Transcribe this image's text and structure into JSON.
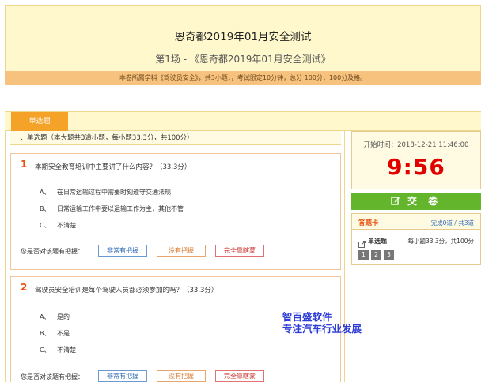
{
  "header": {
    "exam_title": "恩奇都2019年01月安全测试",
    "session_title": "第1场 - 《恩奇都2019年01月安全测试》",
    "notice": "本卷所属学科《驾驶员安全》，共3小题，，考试限定10分钟，总分 100分，100分及格。"
  },
  "tabs": [
    {
      "label": "单选题"
    }
  ],
  "section": {
    "header": "一、单选题（本大题共3道小题，每小题33.3分，共100分）"
  },
  "questions": [
    {
      "number": "1",
      "text": "本期安全教育培训中主要讲了什么内容？（33.3分）",
      "options": [
        {
          "letter": "A、",
          "text": "在日常运输过程中需要时刻遵守交通法规"
        },
        {
          "letter": "B、",
          "text": "日常运输工作中要以运输工作为主，其他不管"
        },
        {
          "letter": "C、",
          "text": "不清楚"
        }
      ]
    },
    {
      "number": "2",
      "text": "驾驶员安全培训是每个驾驶人员都必须参加的吗？（33.3分）",
      "options": [
        {
          "letter": "A、",
          "text": "是的"
        },
        {
          "letter": "B、",
          "text": "不是"
        },
        {
          "letter": "C、",
          "text": "不清楚"
        }
      ]
    }
  ],
  "confidence": {
    "label": "您是否对该题有把握：",
    "buttons": [
      "非常有把握",
      "没有把握",
      "完全靠瞎蒙"
    ]
  },
  "sidebar": {
    "start_time": "开始时间：2018-12-21 11:46:00",
    "countdown": "9:56",
    "submit_label": "交 卷",
    "answer_card": {
      "title": "答题卡",
      "progress": "完成0道 / 共3道",
      "type_label": "单选题",
      "score_info": "每小题33.3分，共100分",
      "numbers": [
        "1",
        "2",
        "3"
      ]
    }
  },
  "watermark": {
    "line1": "智百盛软件",
    "line2": "专注汽车行业发展"
  },
  "colors": {
    "accent": "#f5a328",
    "banner": "#fff8cc",
    "timer": "#e00000",
    "submit": "#63b62c"
  }
}
